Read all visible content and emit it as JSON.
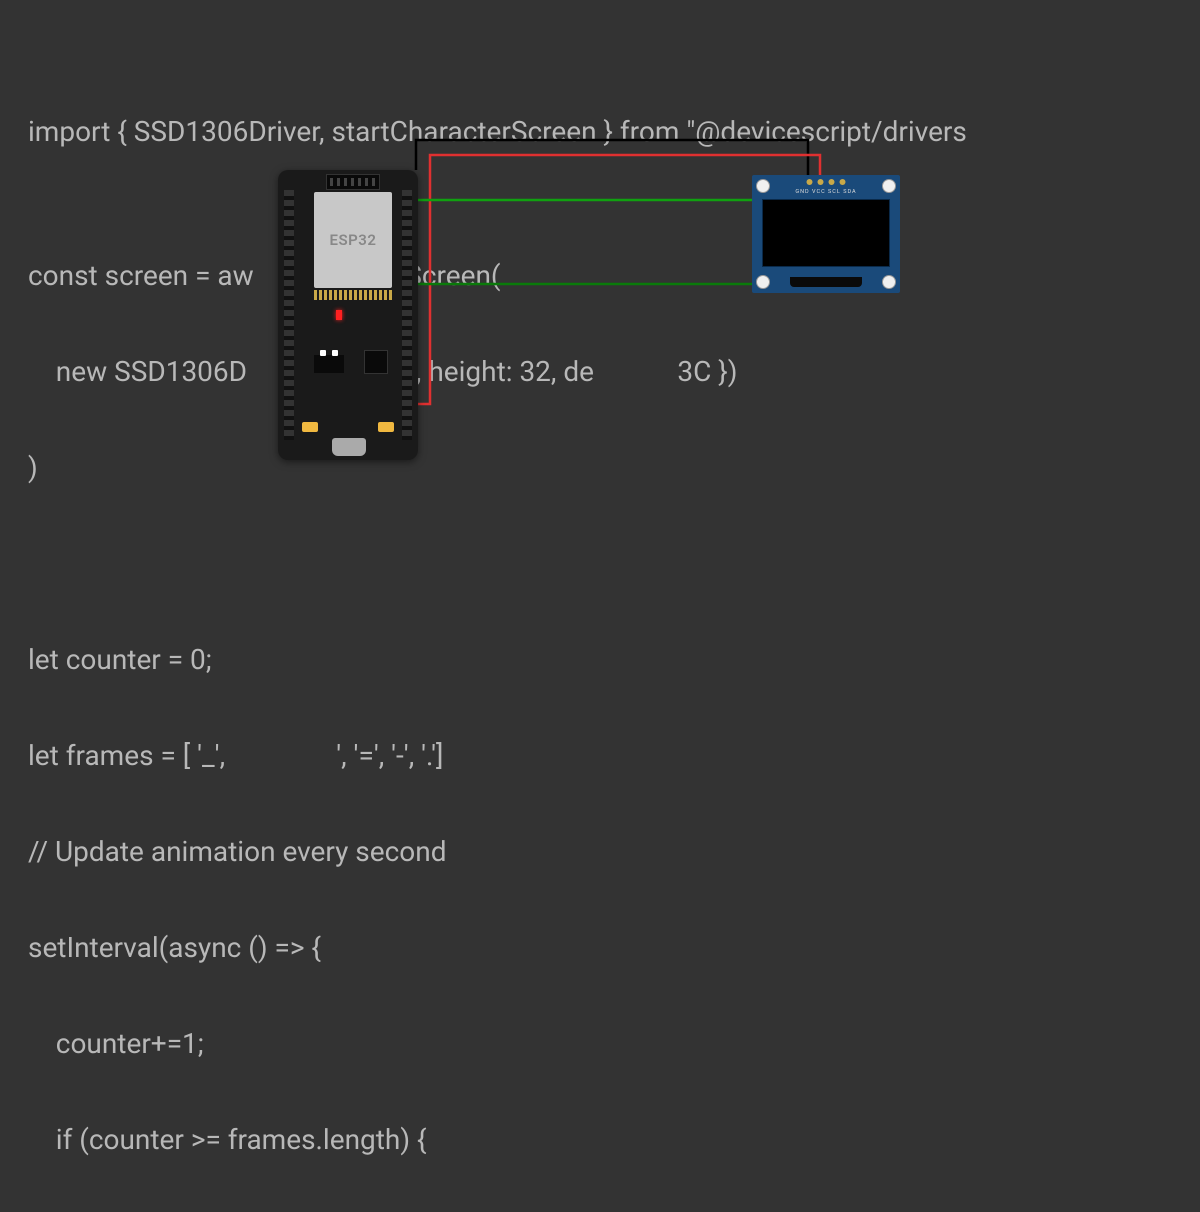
{
  "code": {
    "line1": "import { SSD1306Driver, startCharacterScreen } from \"@devicescript/drivers",
    "line2": "",
    "line3": "const screen = aw       haracterScreen(",
    "line4": "    new SSD1306D            th: 128, height: 32, de            3C })",
    "line5": ")",
    "line6": "",
    "line7": "",
    "line8": "let counter = 0;",
    "line9": "let frames = [ '_',                ', '=', '-', '.']",
    "line10": "// Update animation every second",
    "line11": "setInterval(async () => {",
    "line12": "    counter+=1;",
    "line13": "    if (counter >= frames.length) {"
  },
  "board": {
    "chipLabel": "ESP32"
  },
  "oled": {
    "pinLabels": "GND VCC SCL SDA"
  },
  "wires": {
    "gnd": "#000000",
    "vcc": "#e03030",
    "scl": "#10a010",
    "sda": "#0a7a0a"
  }
}
